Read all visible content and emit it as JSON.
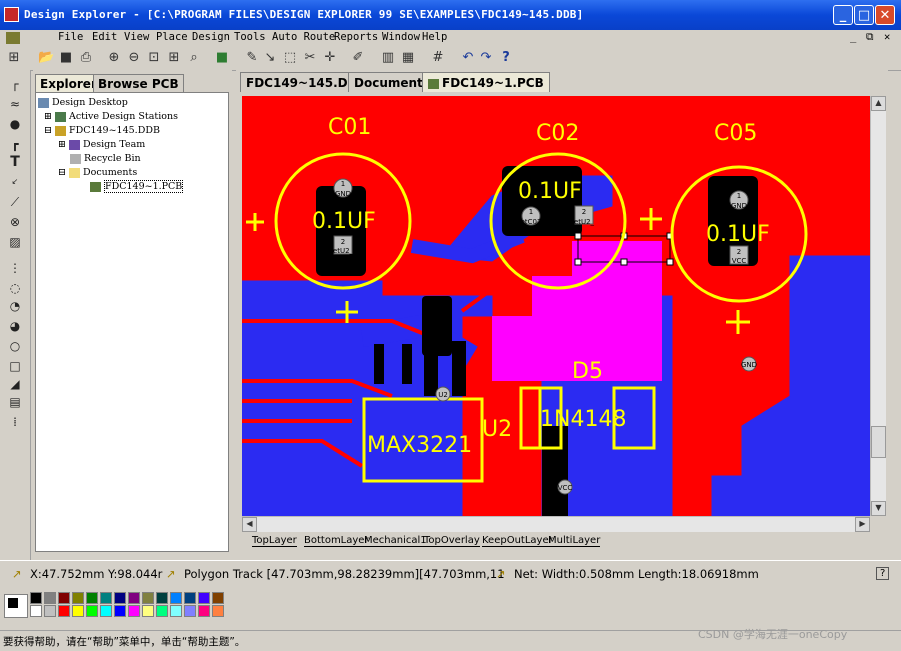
{
  "window": {
    "title": "Design Explorer - [C:\\PROGRAM FILES\\DESIGN EXPLORER 99 SE\\EXAMPLES\\FDC149~145.DDB]",
    "controls": [
      "_",
      "□",
      "✕"
    ]
  },
  "menu": {
    "items": [
      "File",
      "Edit",
      "View",
      "Place",
      "Design",
      "Tools",
      "Auto Route",
      "Reports",
      "Window",
      "Help"
    ],
    "mdi_controls": [
      "_",
      "⧉",
      "✕"
    ]
  },
  "explorer": {
    "tabs": [
      "Explorer",
      "Browse PCB"
    ],
    "tree": [
      {
        "label": "Design Desktop"
      },
      {
        "label": "Active Design Stations"
      },
      {
        "label": "FDC149~145.DDB"
      },
      {
        "label": "Design Team"
      },
      {
        "label": "Recycle Bin"
      },
      {
        "label": "Documents"
      },
      {
        "label": "FDC149~1.PCB"
      }
    ]
  },
  "document": {
    "tabs": [
      "FDC149~145.DDB",
      "Documents",
      "FDC149~1.PCB"
    ],
    "layers": [
      "TopLayer",
      "BottomLayer",
      "Mechanical1",
      "TopOverlay",
      "KeepOutLayer",
      "MultiLayer"
    ]
  },
  "pcb": {
    "labels": {
      "c01": "C01",
      "c02": "C02",
      "c05": "C05",
      "val1": "0.1UF",
      "val2": "0.1UF",
      "val3": "0.1UF",
      "d5": "D5",
      "diode": "1N4148",
      "chip": "MAX3221",
      "u2": "U2"
    },
    "pads": {
      "c01_1_num": "1",
      "c01_1_net": "GND",
      "c01_2_num": "2",
      "c01_2_net": "etU2_",
      "c02_1_num": "1",
      "c02_1_net": "etC02",
      "c02_2_num": "2",
      "c02_2_net": "etU2_",
      "c05_1_num": "1",
      "c05_1_net": "GND",
      "c05_2_num": "2",
      "c05_2_net": "VCC",
      "gnd_via": "GND",
      "u2_via": "U2",
      "vcc_via": "VCC"
    },
    "colors": {
      "top": "#ff0000",
      "bottom": "#2b2bf2",
      "overlay": "#ffff00",
      "selection": "#ff00ff",
      "pad": "#c0c0c0"
    }
  },
  "status": {
    "coords": "X:47.752mm Y:98.044r",
    "track": "Polygon Track [47.703mm,98.28239mm][47.703mm,11",
    "net": "Net: Width:0.508mm Length:18.06918mm",
    "help_icon": "?"
  },
  "help": {
    "text": "要获得帮助，请在“帮助”菜单中，单击“帮助主题”。"
  },
  "watermark": "CSDN @学海无涯一oneCopy",
  "palette": {
    "colors_top": [
      "#000000",
      "#808080",
      "#800000",
      "#808000",
      "#008000",
      "#008080",
      "#000080",
      "#800080",
      "#808040",
      "#004040",
      "#0080ff",
      "#004080",
      "#4000ff",
      "#804000"
    ],
    "colors_bottom": [
      "#ffffff",
      "#c0c0c0",
      "#ff0000",
      "#ffff00",
      "#00ff00",
      "#00ffff",
      "#0000ff",
      "#ff00ff",
      "#ffff80",
      "#00ff80",
      "#80ffff",
      "#8080ff",
      "#ff0080",
      "#ff8040"
    ]
  }
}
